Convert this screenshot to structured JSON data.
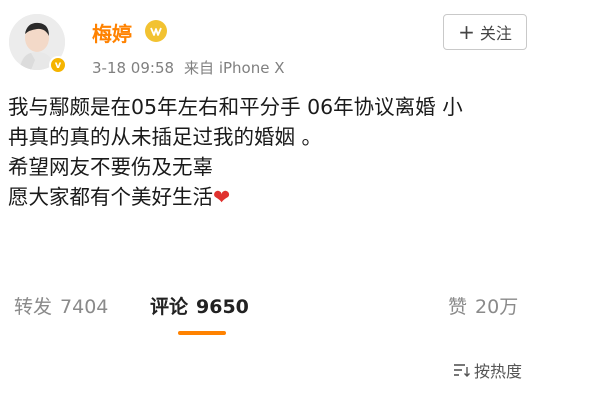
{
  "user": {
    "name": "梅婷",
    "verified_mark": "v"
  },
  "meta": {
    "timestamp": "3-18 09:58",
    "source": "来自 iPhone X"
  },
  "follow": {
    "plus": "+",
    "label": "关注"
  },
  "post": {
    "lines": [
      "我与鄢颇是在05年左右和平分手  06年协议离婚 小",
      "冉真的真的从未插足过我的婚姻 。",
      "希望网友不要伤及无辜",
      "愿大家都有个美好生活"
    ],
    "emoji": "❤"
  },
  "stats": {
    "repost_label": "转发",
    "repost_count": "7404",
    "comment_label": "评论",
    "comment_count": "9650",
    "like_label": "赞",
    "like_count": "20万"
  },
  "sort": {
    "label": "按热度"
  },
  "colors": {
    "username": "#ff8200",
    "accent_underline": "#ff8200",
    "heart": "#e0322f"
  },
  "icons": {
    "level_badge": "level-badge-icon",
    "sort": "sort-icon",
    "heart": "heart-icon"
  }
}
